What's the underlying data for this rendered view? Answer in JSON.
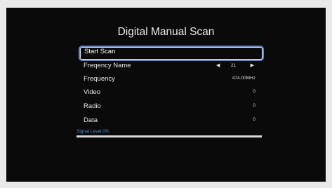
{
  "title": "Digital Manual Scan",
  "menu": {
    "start_scan": "Start Scan",
    "freqency_name_label": "Freqency Name",
    "freqency_name_value": "21",
    "frequency_label": "Frequency",
    "frequency_value": "474.00MHz",
    "video_label": "Video",
    "video_value": "0",
    "radio_label": "Radio",
    "radio_value": "0",
    "data_label": "Data",
    "data_value": "0"
  },
  "signal": {
    "label": "Signal Level:0%",
    "level_percent": 0
  },
  "icons": {
    "left": "left-arrow-icon",
    "right": "right-arrow-icon"
  },
  "colors": {
    "screen_bg": "#0a0a0a",
    "accent": "#5b8ccc"
  }
}
